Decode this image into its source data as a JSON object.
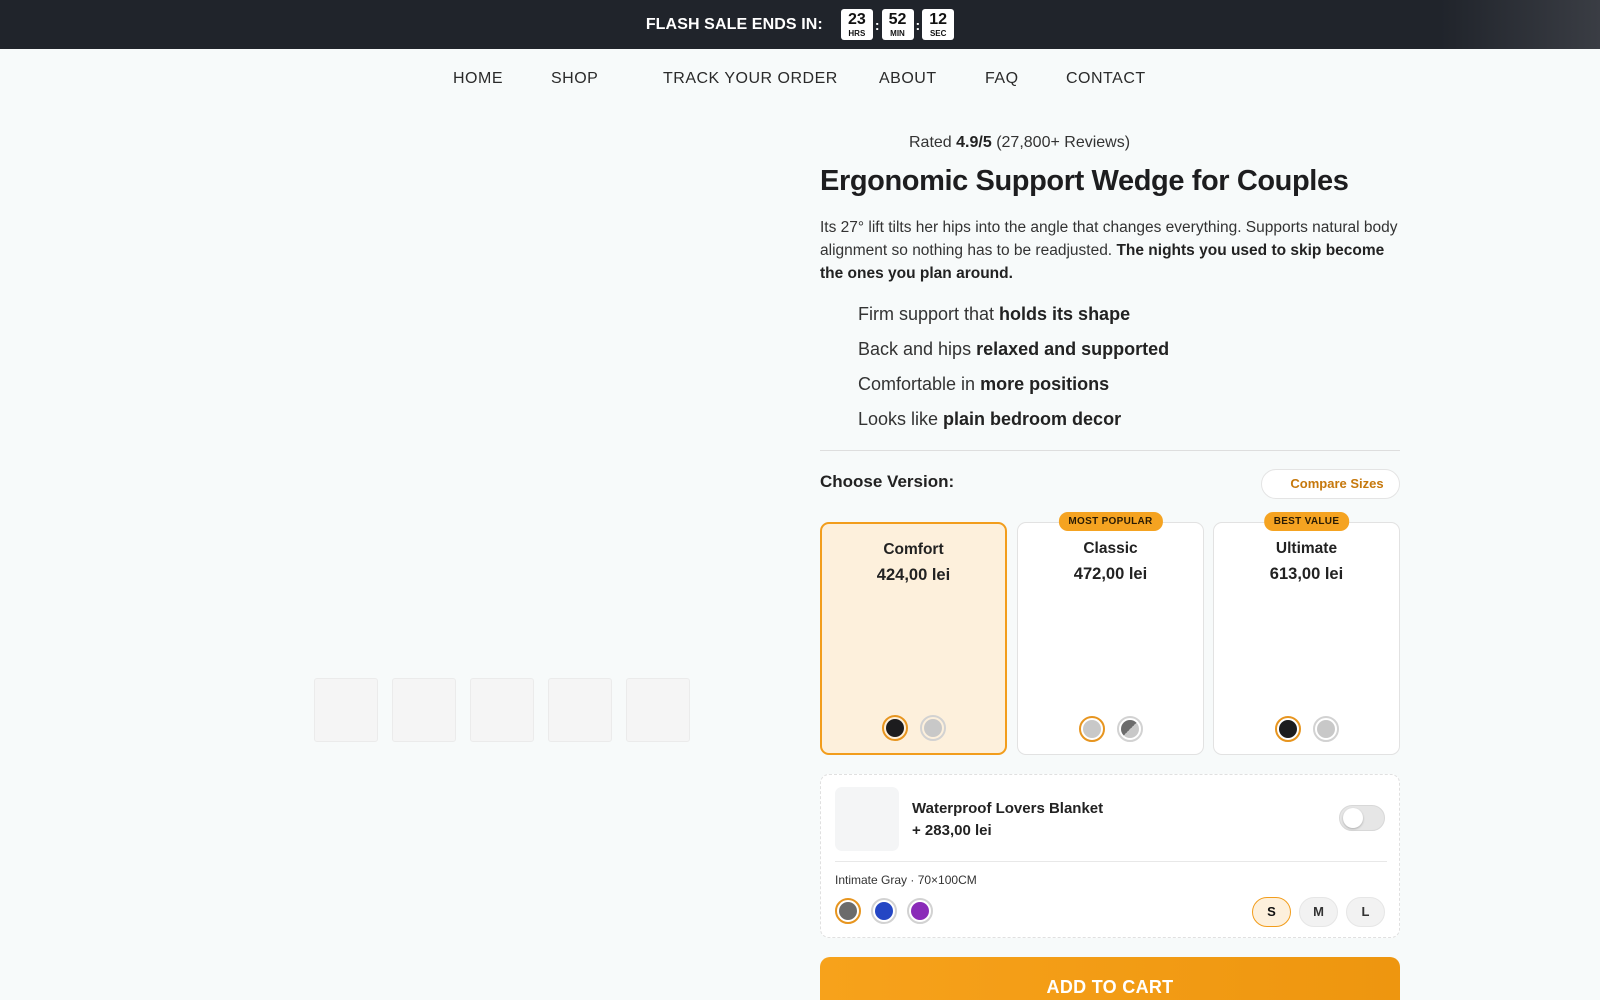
{
  "flash": {
    "label": "FLASH SALE ENDS IN:",
    "hours": "23",
    "hours_unit": "HRS",
    "minutes": "52",
    "minutes_unit": "MIN",
    "seconds": "12",
    "seconds_unit": "SEC"
  },
  "nav": {
    "items": [
      {
        "label": "HOME"
      },
      {
        "label": "SHOP"
      },
      {
        "label": "TRACK YOUR ORDER"
      },
      {
        "label": "ABOUT"
      },
      {
        "label": "FAQ"
      },
      {
        "label": "CONTACT"
      }
    ]
  },
  "product": {
    "rating_prefix": "Rated",
    "rating_value": "4.9/5",
    "rating_count": "(27,800+ Reviews)",
    "title": "Ergonomic Support Wedge for Couples",
    "desc_regular": "Its 27° lift tilts her hips into the angle that changes everything. Supports natural body alignment so nothing has to be readjusted. ",
    "desc_bold": "The nights you used to skip become the ones you plan around.",
    "features": [
      {
        "text": "Firm support that ",
        "bold": "holds its shape"
      },
      {
        "text": "Back and hips ",
        "bold": "relaxed and supported"
      },
      {
        "text": "Comfortable in ",
        "bold": "more positions"
      },
      {
        "text": "Looks like ",
        "bold": "plain bedroom decor"
      }
    ]
  },
  "versions": {
    "heading": "Choose Version:",
    "compare_label": "Compare Sizes",
    "options": [
      {
        "name": "Comfort",
        "price": "424,00 lei",
        "badge": "",
        "selected": true,
        "swatches": [
          {
            "color": "#1c1c1e",
            "active": true
          },
          {
            "color": "#c8c8c8",
            "active": false
          }
        ]
      },
      {
        "name": "Classic",
        "price": "472,00 lei",
        "badge": "MOST POPULAR",
        "selected": false,
        "swatches": [
          {
            "color": "#c8c8c8",
            "active": true
          },
          {
            "color": "#6b6b6b",
            "active": false
          }
        ]
      },
      {
        "name": "Ultimate",
        "price": "613,00 lei",
        "badge": "BEST VALUE",
        "selected": false,
        "swatches": [
          {
            "color": "#1c1c1e",
            "active": true
          },
          {
            "color": "#c8c8c8",
            "active": false
          }
        ]
      }
    ]
  },
  "addon": {
    "name": "Waterproof Lovers Blanket",
    "price": "+ 283,00 lei",
    "enabled": false,
    "variant": "Intimate Gray · 70×100CM",
    "swatches": [
      {
        "color": "#6b6b6b",
        "active": true
      },
      {
        "color": "#2446c4",
        "active": false
      },
      {
        "color": "#8a2ab8",
        "active": false
      }
    ],
    "sizes": [
      {
        "label": "S",
        "active": true
      },
      {
        "label": "M",
        "active": false
      },
      {
        "label": "L",
        "active": false
      }
    ]
  },
  "cta": {
    "label": "ADD TO CART"
  },
  "colors": {
    "accent": "#f29d1c",
    "accent_text": "#c6780c",
    "topbar": "#20242b"
  }
}
